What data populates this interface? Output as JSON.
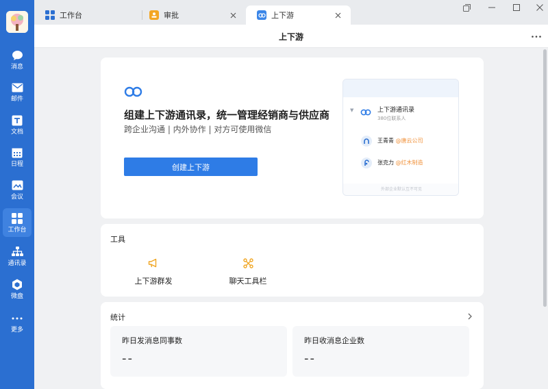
{
  "sidebar": {
    "items": [
      {
        "label": "消息",
        "icon": "chat-bubble-icon"
      },
      {
        "label": "邮件",
        "icon": "mail-icon"
      },
      {
        "label": "文档",
        "icon": "document-icon"
      },
      {
        "label": "日程",
        "icon": "calendar-icon"
      },
      {
        "label": "会议",
        "icon": "meeting-icon"
      },
      {
        "label": "工作台",
        "icon": "workbench-grid-icon",
        "active": true
      },
      {
        "label": "通讯录",
        "icon": "org-chart-icon"
      },
      {
        "label": "微盘",
        "icon": "cloud-drive-icon"
      },
      {
        "label": "更多",
        "icon": "more-dots-icon"
      }
    ]
  },
  "tabs": [
    {
      "label": "工作台",
      "icon": "workbench-grid-icon"
    },
    {
      "label": "审批",
      "icon": "approval-icon"
    },
    {
      "label": "上下游",
      "icon": "link-icon",
      "active": true
    }
  ],
  "header": {
    "title": "上下游"
  },
  "hero": {
    "title": "组建上下游通讯录，统一管理经销商与供应商",
    "subtitle": "跨企业沟通 | 内外协作 | 对方可使用微信",
    "button_label": "创建上下游",
    "preview": {
      "title": "上下游通讯录",
      "count": "380位联系人",
      "contacts": [
        {
          "name": "王青青",
          "org": "@唐云公司"
        },
        {
          "name": "张克力",
          "org": "@红木制造"
        }
      ],
      "footer": "外部企业默认互不可见"
    }
  },
  "tools": {
    "title": "工具",
    "items": [
      {
        "label": "上下游群发",
        "icon": "megaphone-icon"
      },
      {
        "label": "聊天工具栏",
        "icon": "toolbar-icon"
      }
    ]
  },
  "stats": {
    "title": "统计",
    "items": [
      {
        "label": "昨日发消息同事数",
        "value": "--"
      },
      {
        "label": "昨日收消息企业数",
        "value": "--"
      }
    ]
  },
  "colors": {
    "sidebar": "#2b6fd1",
    "accent": "#2e7ce6",
    "org_highlight": "#f0913a"
  }
}
